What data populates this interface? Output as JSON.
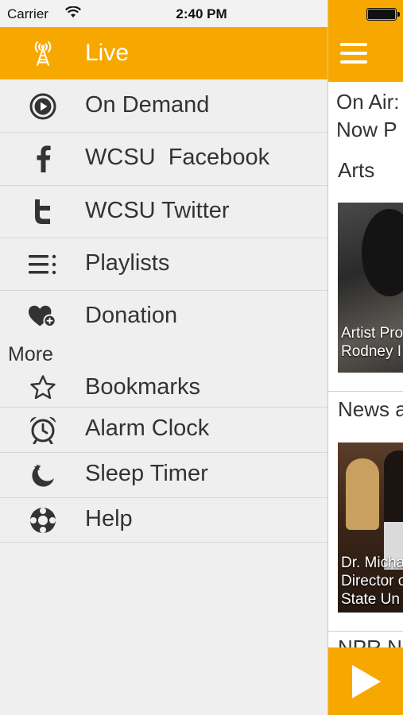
{
  "status_bar": {
    "carrier": "Carrier",
    "time": "2:40 PM"
  },
  "drawer": {
    "live_label": "Live",
    "items": [
      {
        "label": "On Demand",
        "icon": "play-circle-icon"
      },
      {
        "label": "WCSU  Facebook",
        "icon": "facebook-icon"
      },
      {
        "label": "WCSU Twitter",
        "icon": "twitter-icon"
      },
      {
        "label": "Playlists",
        "icon": "list-icon"
      },
      {
        "label": "Donation",
        "icon": "heart-plus-icon"
      }
    ],
    "more_label": "More",
    "more_items": [
      {
        "label": "Bookmarks",
        "icon": "star-icon"
      },
      {
        "label": "Alarm Clock",
        "icon": "alarm-clock-icon"
      },
      {
        "label": "Sleep Timer",
        "icon": "moon-star-icon"
      },
      {
        "label": "Help",
        "icon": "lifebuoy-icon"
      }
    ]
  },
  "content": {
    "on_air": "On Air:",
    "now_playing": "Now P",
    "sections": [
      {
        "title": "Arts",
        "caption_line1": "Artist Pro",
        "caption_line2": "Rodney I"
      },
      {
        "title": "News a",
        "caption_line1": "Dr. Micha",
        "caption_line2": "Director c",
        "caption_line3": "State Un"
      }
    ],
    "next_section_title": "NPR N"
  },
  "colors": {
    "accent": "#f7a800",
    "drawer_bg": "#efefef",
    "text": "#333333"
  }
}
